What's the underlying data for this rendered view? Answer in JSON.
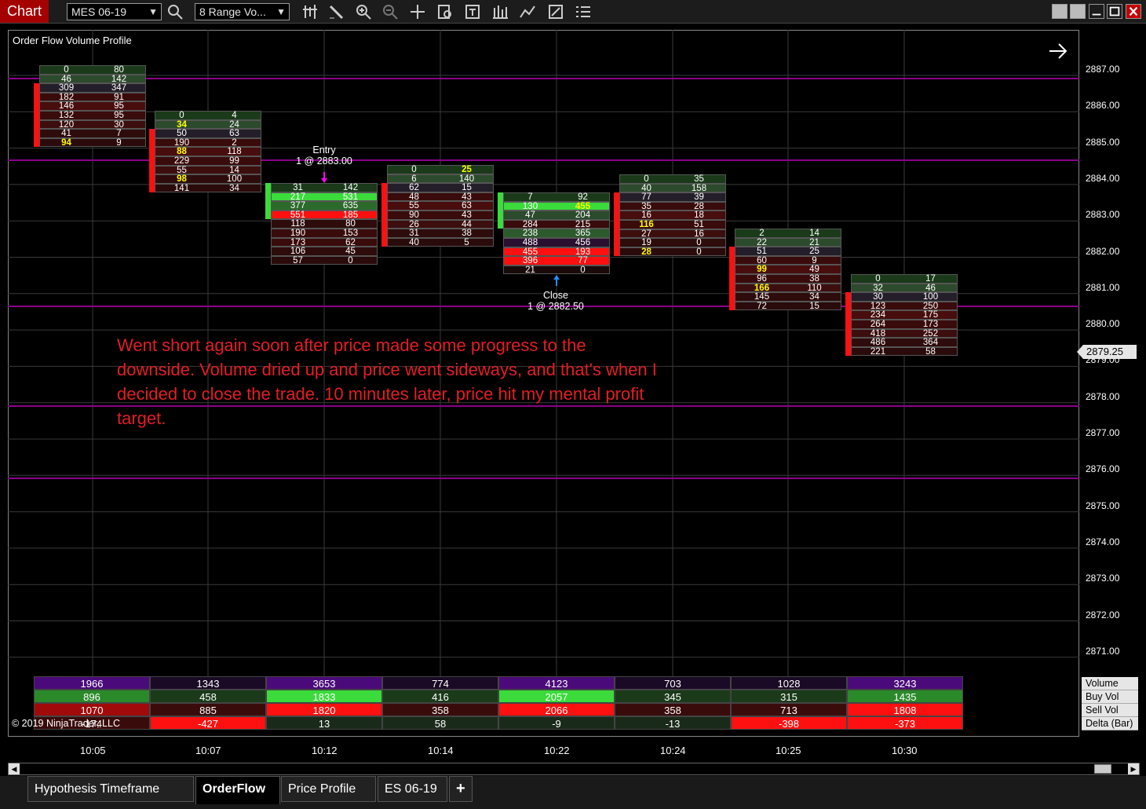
{
  "toolbar": {
    "title": "Chart",
    "instrument": "MES 06-19",
    "bar_type": "8 Range Vo...",
    "icons": [
      "search-icon",
      "bar-type-icon",
      "draw-tool-icon",
      "zoom-in-icon",
      "zoom-out-icon",
      "crosshair-icon",
      "chart-trader-icon",
      "properties-icon",
      "data-box-icon",
      "strategy-icon",
      "indicators-icon",
      "templates-icon"
    ],
    "window_buttons": [
      "link-icon",
      "link2-icon",
      "minimize-icon",
      "maximize-icon",
      "close-icon"
    ]
  },
  "chart": {
    "title": "Order Flow Volume Profile",
    "current_price": "2879.25",
    "price_labels": [
      "2887.00",
      "2886.00",
      "2885.00",
      "2884.00",
      "2883.00",
      "2882.00",
      "2881.00",
      "2880.00",
      "2879.00",
      "2878.00",
      "2877.00",
      "2876.00",
      "2875.00",
      "2874.00",
      "2873.00",
      "2872.00",
      "2871.00"
    ],
    "time_labels": [
      "10:05",
      "10:07",
      "10:12",
      "10:14",
      "10:22",
      "10:24",
      "10:25",
      "10:30"
    ],
    "entry": {
      "label": "Entry",
      "detail": "1 @ 2883.00"
    },
    "close": {
      "label": "Close",
      "detail": "1 @ 2882.50"
    },
    "annotation": "Went short again soon after price made some progress to the downside. Volume dried up and price went sideways, and that's when I decided to close the trade. 10 minutes later, price hit my mental profit target.",
    "copyright": "© 2019 NinjaTrader, LLC",
    "colors": {
      "up": "#3adb3a",
      "down": "#ff1010",
      "level_line": "#8a008a",
      "annotation": "#e31e24"
    }
  },
  "bars": [
    {
      "candle": "down",
      "rows": [
        [
          "0",
          "80"
        ],
        [
          "46",
          "142"
        ],
        [
          "309",
          "347"
        ],
        [
          "182",
          "91"
        ],
        [
          "146",
          "95"
        ],
        [
          "132",
          "95"
        ],
        [
          "120",
          "30"
        ],
        [
          "41",
          "7"
        ],
        [
          "94",
          "9"
        ]
      ],
      "yellow_l": [
        8
      ]
    },
    {
      "candle": "down",
      "rows": [
        [
          "0",
          "4"
        ],
        [
          "34",
          "24"
        ],
        [
          "50",
          "63"
        ],
        [
          "190",
          "2"
        ],
        [
          "88",
          "118"
        ],
        [
          "229",
          "99"
        ],
        [
          "55",
          "14"
        ],
        [
          "98",
          "100"
        ],
        [
          "141",
          "34"
        ]
      ],
      "yellow_l": [
        1,
        4,
        7
      ]
    },
    {
      "candle": "up",
      "rows": [
        [
          "31",
          "142"
        ],
        [
          "217",
          "531"
        ],
        [
          "377",
          "635"
        ],
        [
          "551",
          "185"
        ],
        [
          "118",
          "80"
        ],
        [
          "190",
          "153"
        ],
        [
          "173",
          "62"
        ],
        [
          "106",
          "45"
        ],
        [
          "57",
          "0"
        ]
      ],
      "yellow_l": []
    },
    {
      "candle": "down",
      "rows": [
        [
          "0",
          "25"
        ],
        [
          "6",
          "140"
        ],
        [
          "62",
          "15"
        ],
        [
          "48",
          "43"
        ],
        [
          "55",
          "63"
        ],
        [
          "90",
          "43"
        ],
        [
          "26",
          "44"
        ],
        [
          "31",
          "38"
        ],
        [
          "40",
          "5"
        ]
      ],
      "yellow_r": [
        0
      ]
    },
    {
      "candle": "up",
      "rows": [
        [
          "7",
          "92"
        ],
        [
          "130",
          "455"
        ],
        [
          "47",
          "204"
        ],
        [
          "284",
          "215"
        ],
        [
          "238",
          "365"
        ],
        [
          "488",
          "456"
        ],
        [
          "455",
          "193"
        ],
        [
          "396",
          "77"
        ],
        [
          "21",
          "0"
        ]
      ],
      "yellow_r": [
        1
      ]
    },
    {
      "candle": "down",
      "rows": [
        [
          "0",
          "35"
        ],
        [
          "40",
          "158"
        ],
        [
          "77",
          "39"
        ],
        [
          "35",
          "28"
        ],
        [
          "16",
          "18"
        ],
        [
          "116",
          "51"
        ],
        [
          "27",
          "16"
        ],
        [
          "19",
          "0"
        ],
        [
          "28",
          "0"
        ]
      ],
      "yellow_l": [
        5,
        8
      ]
    },
    {
      "candle": "down",
      "rows": [
        [
          "2",
          "14"
        ],
        [
          "22",
          "21"
        ],
        [
          "51",
          "25"
        ],
        [
          "60",
          "9"
        ],
        [
          "99",
          "49"
        ],
        [
          "96",
          "38"
        ],
        [
          "166",
          "110"
        ],
        [
          "145",
          "34"
        ],
        [
          "72",
          "15"
        ]
      ],
      "yellow_l": [
        4,
        6
      ]
    },
    {
      "candle": "down",
      "rows": [
        [
          "0",
          "17"
        ],
        [
          "32",
          "46"
        ],
        [
          "30",
          "100"
        ],
        [
          "123",
          "250"
        ],
        [
          "234",
          "175"
        ],
        [
          "264",
          "173"
        ],
        [
          "418",
          "252"
        ],
        [
          "486",
          "364"
        ],
        [
          "221",
          "58"
        ]
      ],
      "yellow_l": []
    }
  ],
  "summary": {
    "legend": [
      "Volume",
      "Buy Vol",
      "Sell Vol",
      "Delta (Bar)"
    ],
    "volume": [
      "1966",
      "1343",
      "3653",
      "774",
      "4123",
      "703",
      "1028",
      "3243"
    ],
    "buy": [
      "896",
      "458",
      "1833",
      "416",
      "2057",
      "345",
      "315",
      "1435"
    ],
    "sell": [
      "1070",
      "885",
      "1820",
      "358",
      "2066",
      "358",
      "713",
      "1808"
    ],
    "delta": [
      "-174",
      "-427",
      "13",
      "58",
      "-9",
      "-13",
      "-398",
      "-373"
    ]
  },
  "tabs": [
    "Hypothesis Timeframe",
    "OrderFlow",
    "Price Profile",
    "ES 06-19",
    "+"
  ]
}
